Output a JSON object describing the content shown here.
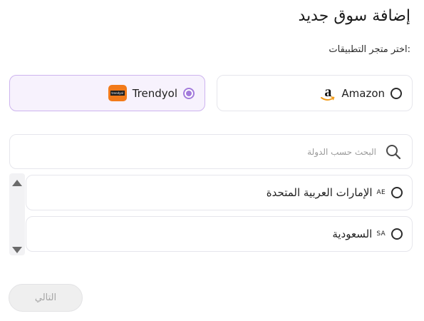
{
  "header": {
    "title": "إضافة سوق جديد",
    "subtitle": ":اختر متجر التطبيقات"
  },
  "stores": [
    {
      "name": "Amazon",
      "icon": "amazon-logo-icon",
      "selected": false
    },
    {
      "name": "Trendyol",
      "icon": "trendyol-logo-icon",
      "selected": true,
      "accent": "#a37bdc"
    }
  ],
  "search": {
    "placeholder": "البحث حسب الدولة",
    "value": "",
    "icon": "search-icon"
  },
  "countries": [
    {
      "code": "AE",
      "name": "الإمارات العربية المتحدة",
      "selected": false
    },
    {
      "code": "SA",
      "name": "السعودية",
      "selected": false
    }
  ],
  "actions": {
    "next_label": "التالي",
    "next_disabled": true
  }
}
